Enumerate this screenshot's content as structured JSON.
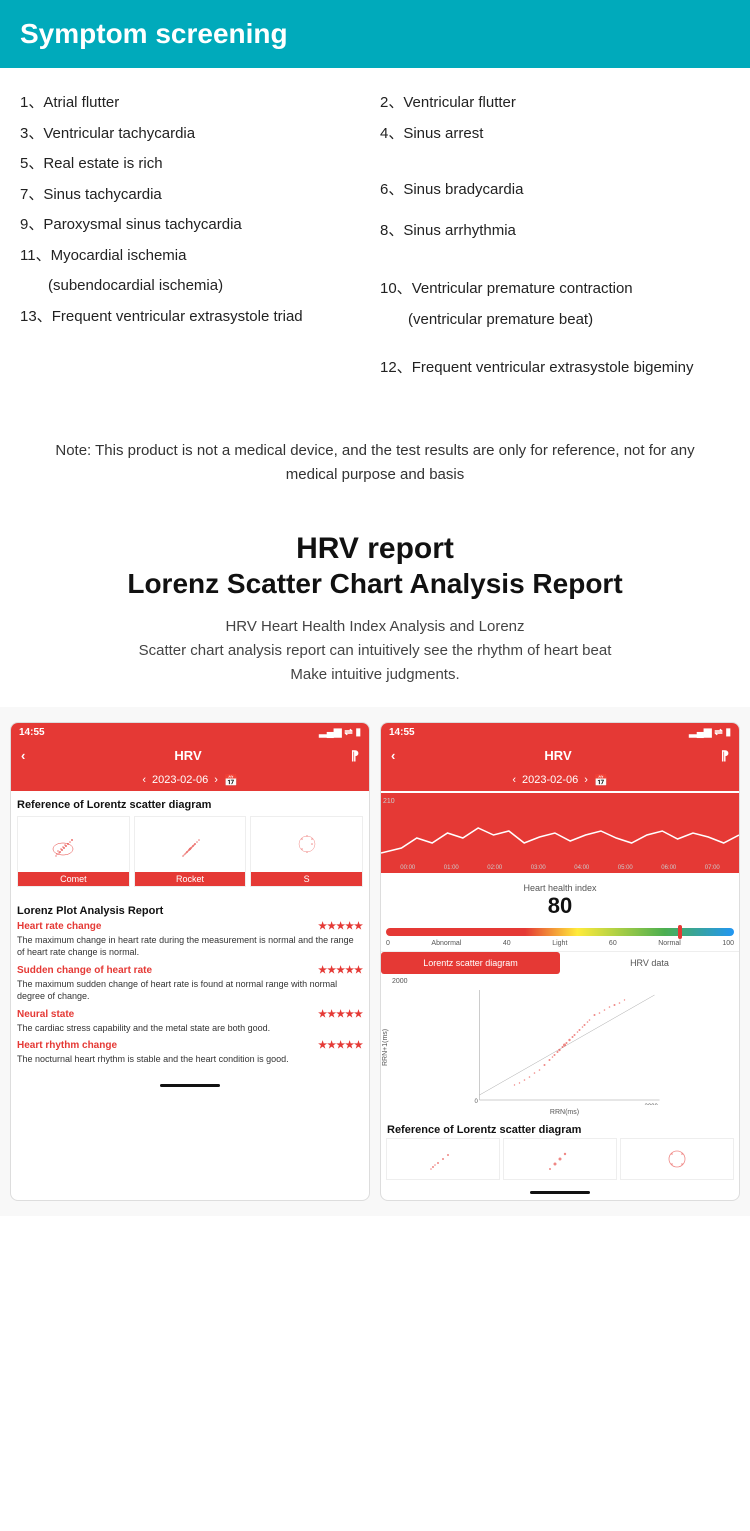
{
  "header": {
    "title": "Symptom screening",
    "bg_color": "#00AABB"
  },
  "symptoms": [
    {
      "num": "1、",
      "text": "Atrial flutter",
      "col": 0
    },
    {
      "num": "2、",
      "text": "Ventricular flutter",
      "col": 1
    },
    {
      "num": "3、",
      "text": "Ventricular tachycardia",
      "col": 0
    },
    {
      "num": "4、",
      "text": "Sinus arrest",
      "col": 1
    },
    {
      "num": "5、",
      "text": "Real estate is rich",
      "col": 0
    },
    {
      "num": "6、",
      "text": "Sinus bradycardia",
      "col": 1
    },
    {
      "num": "7、",
      "text": "Sinus tachycardia",
      "col": 0
    },
    {
      "num": "8、",
      "text": "Sinus arrhythmia",
      "col": 1
    },
    {
      "num": "9、",
      "text": "Paroxysmal sinus tachycardia",
      "col": 0
    },
    {
      "num": "10、",
      "text": "Ventricular premature contraction",
      "col": 1
    },
    {
      "num": "11、",
      "text": "Myocardial ischemia",
      "col": 0
    },
    {
      "num": "11_sub",
      "text": "(subendocardial ischemia)",
      "col": 0
    },
    {
      "num": "10_sub",
      "text": "(ventricular premature beat)",
      "col": 1
    },
    {
      "num": "13、",
      "text": "Frequent ventricular extrasystole triad",
      "col": 0
    },
    {
      "num": "12、",
      "text": "Frequent ventricular extrasystole bigeminy",
      "col": 1
    }
  ],
  "note": "Note: This product is not a medical device, and the test results are only for reference, not for any medical purpose and basis",
  "hrv": {
    "title1": "HRV report",
    "title2": "Lorenz Scatter Chart Analysis Report",
    "desc": "HRV Heart Health Index Analysis and Lorenz\nScatter chart analysis report can intuitively see the rhythm of heart beat\nMake intuitive judgments."
  },
  "left_phone": {
    "status_time": "14:55",
    "nav_title": "HRV",
    "date": "2023-02-06",
    "ref_title": "Reference of Lorentz scatter diagram",
    "thumbnails": [
      {
        "label": "Comet"
      },
      {
        "label": "Rocket"
      },
      {
        "label": "S"
      }
    ],
    "analysis_title": "Lorenz Plot Analysis Report",
    "metrics": [
      {
        "name": "Heart rate change",
        "stars": "★★★★★",
        "desc": "The maximum change in heart rate during the measurement is normal and the range of heart rate change is normal."
      },
      {
        "name": "Sudden change of heart rate",
        "stars": "★★★★★",
        "desc": "The maximum sudden change of heart rate is found at normal range with normal degree of change."
      },
      {
        "name": "Neural state",
        "stars": "★★★★★",
        "desc": "The cardiac stress capability and the metal state are both good."
      },
      {
        "name": "Heart rhythm change",
        "stars": "★★★★★",
        "desc": "The nocturnal heart rhythm is stable and the heart condition is good."
      }
    ]
  },
  "right_phone": {
    "status_time": "14:55",
    "nav_title": "HRV",
    "date": "2023-02-06",
    "waveform_y": "210",
    "waveform_x_labels": [
      "00:00",
      "01:00",
      "02:00",
      "03:00",
      "04:00",
      "05:00",
      "06:00",
      "07:00"
    ],
    "hhi_label": "Heart health index",
    "hhi_value": "80",
    "hhi_scale": [
      "0",
      "Abnormal",
      "40",
      "Light",
      "60",
      "Normal",
      "100"
    ],
    "tabs": [
      {
        "label": "Lorentz scatter diagram",
        "active": true
      },
      {
        "label": "HRV data",
        "active": false
      }
    ],
    "scatter": {
      "y_label": "RRN+1(ms)",
      "x_label": "RRN(ms)",
      "y_max": "2000",
      "x_max": "2000",
      "y_min": "0",
      "x_min": "0"
    },
    "bottom_ref_title": "Reference of Lorentz scatter diagram"
  }
}
